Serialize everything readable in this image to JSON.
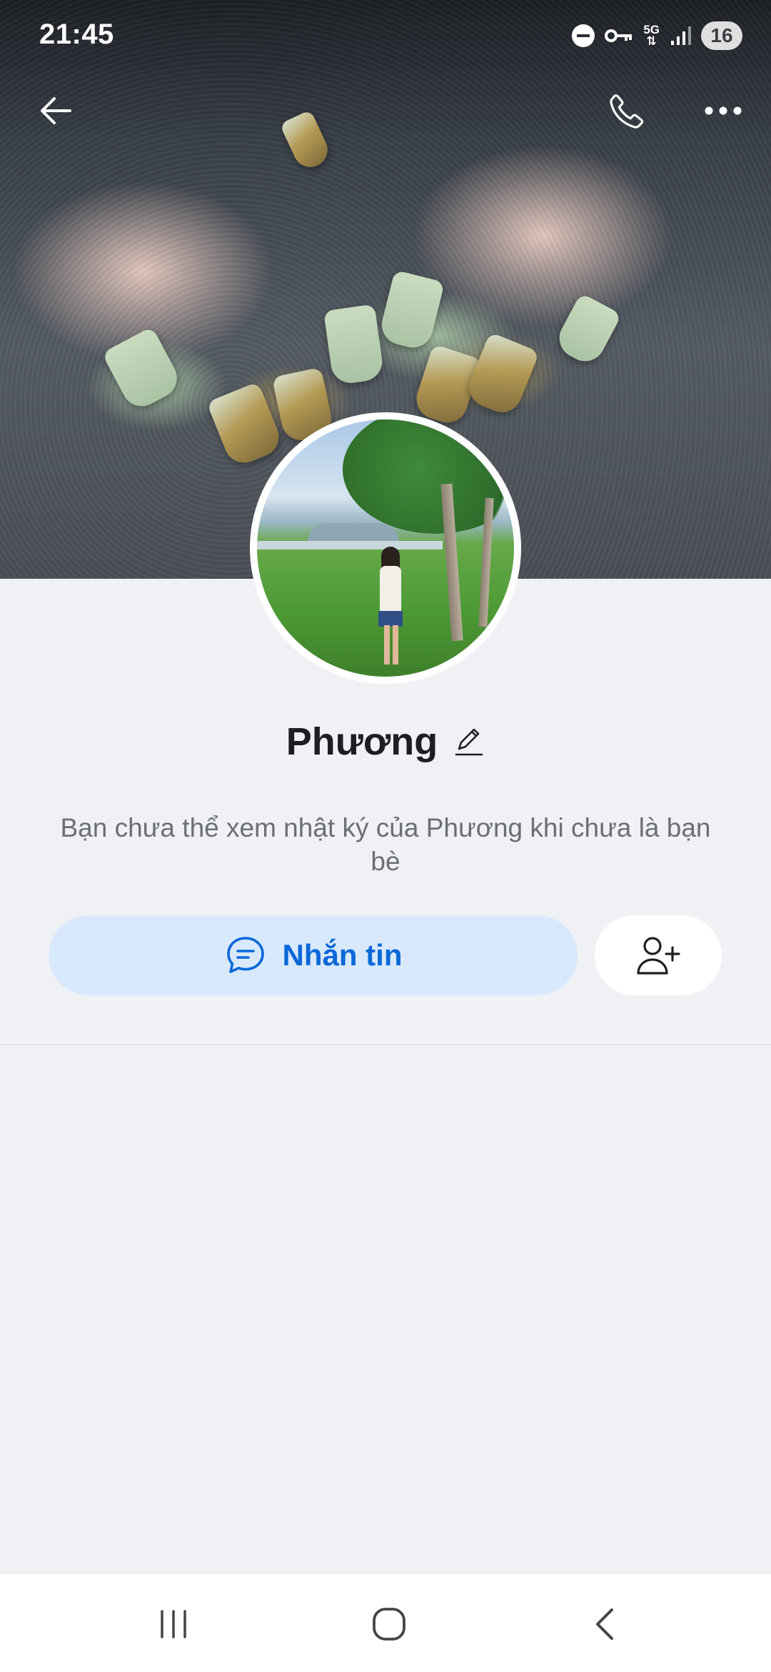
{
  "status_bar": {
    "time": "21:45",
    "network_label": "5G",
    "battery_level": "16",
    "icons": [
      "do-not-disturb-icon",
      "vpn-key-icon",
      "5g-icon",
      "signal-icon",
      "battery-icon"
    ]
  },
  "topbar": {
    "icons": [
      "back-arrow-icon",
      "phone-icon",
      "more-icon"
    ]
  },
  "profile": {
    "name": "Phương",
    "notice": "Bạn chưa thể xem nhật ký của Phương khi chưa là bạn bè"
  },
  "actions": {
    "message_label": "Nhắn tin",
    "message_icon": "chat-bubble-icon",
    "add_friend_icon": "add-friend-icon"
  },
  "navbar": {
    "icons": [
      "recent-apps-icon",
      "home-icon",
      "back-icon"
    ]
  },
  "colors": {
    "background": "#eff1f5",
    "accent": "#0a68d8",
    "message_button_bg": "#d9e9fd"
  }
}
